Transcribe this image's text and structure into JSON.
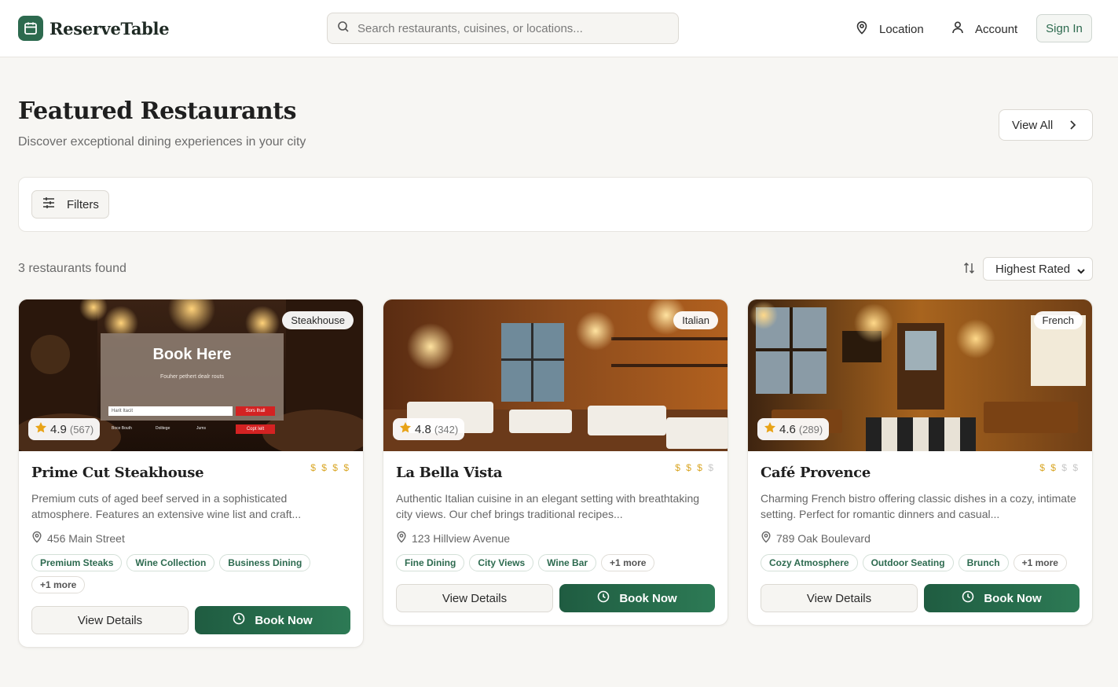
{
  "header": {
    "brand": "ReserveTable",
    "search_placeholder": "Search restaurants, cuisines, or locations...",
    "location_label": "Location",
    "account_label": "Account",
    "signin_label": "Sign In"
  },
  "hero": {
    "title": "Featured Restaurants",
    "subtitle": "Discover exceptional dining experiences in your city",
    "view_all_label": "View All"
  },
  "filters": {
    "label": "Filters"
  },
  "results": {
    "count_text": "3 restaurants found",
    "sort_selected": "Highest Rated"
  },
  "restaurants": [
    {
      "name": "Prime Cut Steakhouse",
      "cuisine": "Steakhouse",
      "rating": "4.9",
      "reviews": "(567)",
      "price_level": 4,
      "description": "Premium cuts of aged beef served in a sophisticated atmosphere. Features an extensive wine list and craft...",
      "address": "456 Main Street",
      "tags": [
        "Premium Steaks",
        "Wine Collection",
        "Business Dining"
      ],
      "more": "+1 more",
      "image_overlay": {
        "heading": "Book Here",
        "sub": "Fouher pethert dealr routs",
        "field": "Harit Itacit",
        "btn1": "Sors Ihall",
        "btn2": "Copt Ielt",
        "opt1": "Boce Bouth",
        "opt2": "Dolitege",
        "opt3": "Jums"
      }
    },
    {
      "name": "La Bella Vista",
      "cuisine": "Italian",
      "rating": "4.8",
      "reviews": "(342)",
      "price_level": 3,
      "description": "Authentic Italian cuisine in an elegant setting with breathtaking city views. Our chef brings traditional recipes...",
      "address": "123 Hillview Avenue",
      "tags": [
        "Fine Dining",
        "City Views",
        "Wine Bar"
      ],
      "more": "+1 more"
    },
    {
      "name": "Café Provence",
      "cuisine": "French",
      "rating": "4.6",
      "reviews": "(289)",
      "price_level": 2,
      "description": "Charming French bistro offering classic dishes in a cozy, intimate setting. Perfect for romantic dinners and casual...",
      "address": "789 Oak Boulevard",
      "tags": [
        "Cozy Atmosphere",
        "Outdoor Seating",
        "Brunch"
      ],
      "more": "+1 more"
    }
  ],
  "actions": {
    "details_label": "View Details",
    "book_label": "Book Now"
  },
  "colors": {
    "brand_green": "#2d6a4f",
    "price_gold": "#d9a625",
    "star": "#e8a317"
  }
}
